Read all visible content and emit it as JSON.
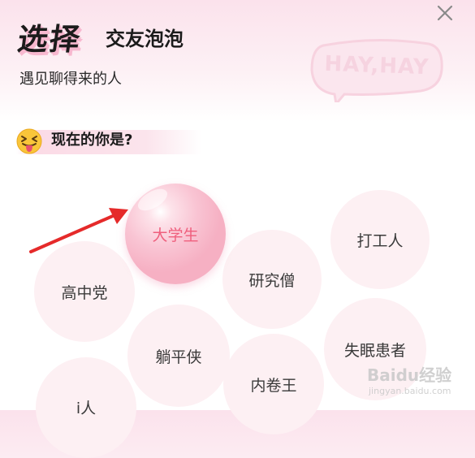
{
  "header": {
    "title_bold": "选择",
    "title_rest": "交友泡泡",
    "subtitle": "遇见聊得来的人",
    "close_icon": "close-icon"
  },
  "decoration": {
    "bubble_text": "HAY,HAY"
  },
  "question": {
    "emoji": "squinting-face-with-tongue",
    "text": "现在的你是?"
  },
  "bubbles": [
    {
      "label": "大学生",
      "selected": true
    },
    {
      "label": "打工人",
      "selected": false
    },
    {
      "label": "高中党",
      "selected": false
    },
    {
      "label": "研究僧",
      "selected": false
    },
    {
      "label": "躺平侠",
      "selected": false
    },
    {
      "label": "失眠患者",
      "selected": false
    },
    {
      "label": "内卷王",
      "selected": false
    },
    {
      "label": "i人",
      "selected": false
    }
  ],
  "annotation": {
    "arrow_color": "#e52a2a"
  },
  "watermark": {
    "text": "Baidu经验",
    "sub": "jingyan.baidu.com"
  },
  "colors": {
    "accent": "#ef5f7d",
    "bubble_bg": "#fdf0f3",
    "header_bg": "#fbe2ec"
  }
}
